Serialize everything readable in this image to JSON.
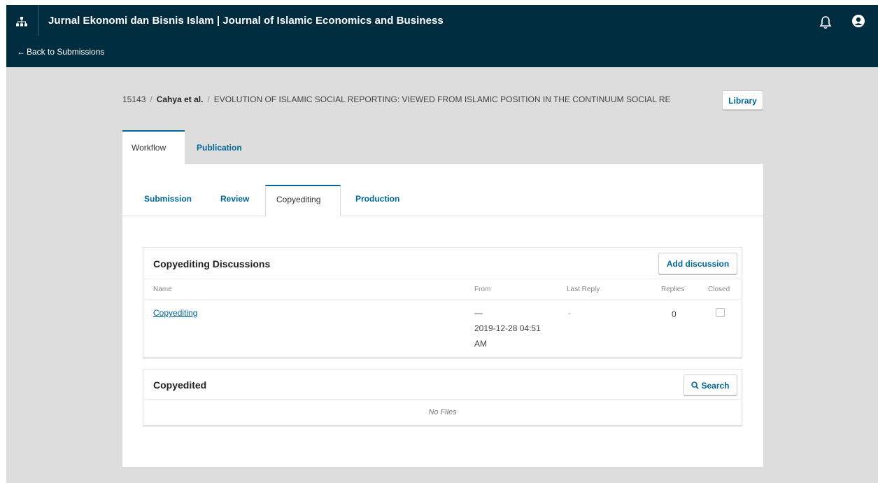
{
  "header": {
    "site_title": "Jurnal Ekonomi dan Bisnis Islam | Journal of Islamic Economics and Business",
    "back_link": "Back to Submissions",
    "icons": [
      "sitemap-icon",
      "bell-icon",
      "user-circle-icon"
    ]
  },
  "breadcrumb": {
    "id": "15143",
    "author": "Cahya et al.",
    "title": "EVOLUTION OF ISLAMIC SOCIAL REPORTING: VIEWED FROM ISLAMIC POSITION IN THE CONTINUUM SOCIAL RE",
    "separator": "/"
  },
  "library_button": "Library",
  "top_tabs": [
    "Workflow",
    "Publication"
  ],
  "stage_tabs": [
    "Submission",
    "Review",
    "Copyediting",
    "Production"
  ],
  "discussions": {
    "title": "Copyediting Discussions",
    "add_button": "Add discussion",
    "columns": [
      "Name",
      "From",
      "Last Reply",
      "Replies",
      "Closed"
    ],
    "rows": [
      {
        "name": "Copyediting",
        "from_line1": "—",
        "from_line2": "2019-12-28 04:51",
        "from_line3": "AM",
        "last_reply": "-",
        "replies": "0",
        "closed": false
      }
    ]
  },
  "copyedited": {
    "title": "Copyedited",
    "search_button": "Search",
    "empty_text": "No Files"
  },
  "colors": {
    "header_bg": "#002c40",
    "accent": "#006798",
    "page_bg": "#dddddd"
  }
}
